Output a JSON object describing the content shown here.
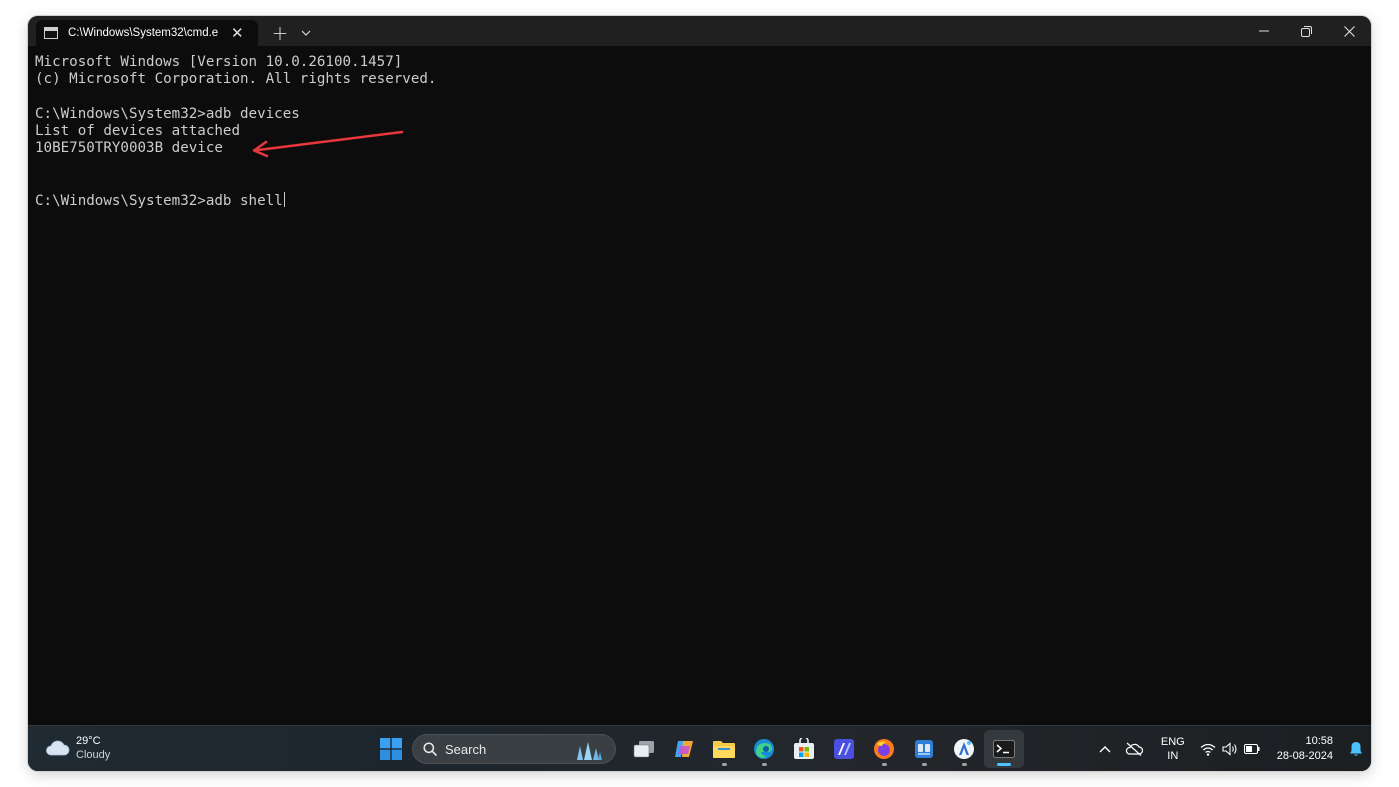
{
  "window": {
    "tab_title": "C:\\Windows\\System32\\cmd.e",
    "tab_close": "✕",
    "new_tab": "+",
    "dropdown": "⌄"
  },
  "terminal": {
    "lines": [
      "Microsoft Windows [Version 10.0.26100.1457]",
      "(c) Microsoft Corporation. All rights reserved.",
      "",
      "C:\\Windows\\System32>adb devices",
      "List of devices attached",
      "10BE750TRY0003B device",
      "",
      "",
      "C:\\Windows\\System32>adb shell"
    ],
    "colors": {
      "background": "#0c0c0c",
      "text": "#cccccc",
      "annotation_arrow": "#e8383d"
    }
  },
  "taskbar": {
    "weather": {
      "temp": "29°C",
      "condition": "Cloudy"
    },
    "search": {
      "label": "Search"
    },
    "apps": [
      {
        "name": "task-view",
        "running": false
      },
      {
        "name": "copilot",
        "running": false
      },
      {
        "name": "file-explorer",
        "running": true
      },
      {
        "name": "edge",
        "running": true
      },
      {
        "name": "microsoft-store",
        "running": false
      },
      {
        "name": "vscode-like-editor",
        "running": false
      },
      {
        "name": "firefox",
        "running": true
      },
      {
        "name": "android-tool",
        "running": true
      },
      {
        "name": "ai-assistant",
        "running": true
      },
      {
        "name": "terminal",
        "running": true,
        "active": true
      }
    ],
    "tray": {
      "lang_top": "ENG",
      "lang_bottom": "IN",
      "time": "10:58",
      "date": "28-08-2024"
    }
  }
}
